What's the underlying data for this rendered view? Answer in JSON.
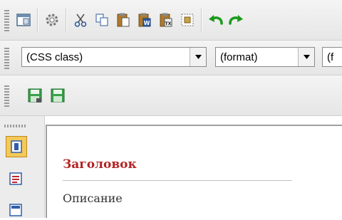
{
  "toolbar_main": {
    "icons": [
      "template-icon",
      "settings-icon",
      "cut-icon",
      "copy-icon",
      "paste-icon",
      "paste-word-icon",
      "paste-text-icon",
      "select-all-icon",
      "undo-icon",
      "redo-icon"
    ]
  },
  "format_bar": {
    "css_class_value": "(CSS class)",
    "format_value": "(format)",
    "font_value": "(f"
  },
  "save_bar": {
    "icons": [
      "save-icon",
      "save-as-icon"
    ]
  },
  "side_panel": {
    "icons": [
      "layout-block-icon",
      "layout-list-icon",
      "layout-columns-icon"
    ]
  },
  "editor": {
    "title": "Заголовок",
    "description": "Описание"
  },
  "colors": {
    "title_red": "#b22222",
    "undo_green": "#1a9a1a",
    "save_green": "#2e8b3a"
  }
}
